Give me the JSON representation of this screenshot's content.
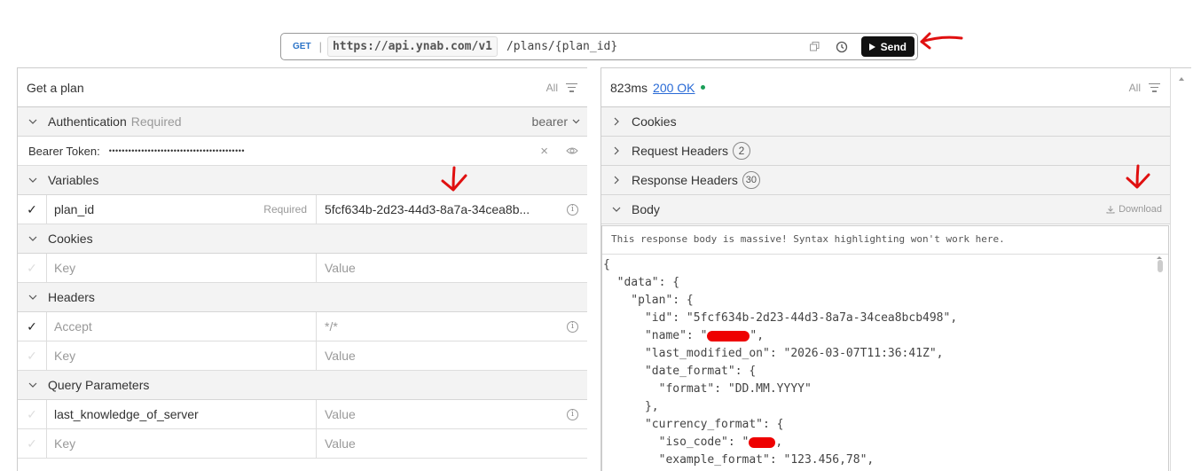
{
  "request": {
    "method": "GET",
    "base_url": "https://api.ynab.com/v1",
    "path": "/plans/{plan_id}",
    "send_label": "Send"
  },
  "left": {
    "title": "Get a plan",
    "filter_label": "All",
    "auth": {
      "label": "Authentication",
      "required": "Required",
      "type": "bearer"
    },
    "bearer_label": "Bearer Token:",
    "bearer_value": "••••••••••••••••••••••••••••••••••••••••••",
    "variables_label": "Variables",
    "variable": {
      "key": "plan_id",
      "tag": "Required",
      "value": "5fcf634b-2d23-44d3-8a7a-34cea8b..."
    },
    "cookies_label": "Cookies",
    "key_placeholder": "Key",
    "value_placeholder": "Value",
    "headers_label": "Headers",
    "header": {
      "key": "Accept",
      "value": "*/*"
    },
    "query_label": "Query Parameters",
    "query": {
      "key": "last_knowledge_of_server",
      "value": "Value"
    }
  },
  "right": {
    "time": "823ms",
    "status": "200 OK",
    "filter_label": "All",
    "cookies_label": "Cookies",
    "req_headers_label": "Request Headers",
    "req_headers_count": "2",
    "resp_headers_label": "Response Headers",
    "resp_headers_count": "30",
    "body_label": "Body",
    "download_label": "Download",
    "body_notice": "This response body is massive! Syntax highlighting won't work here.",
    "code": {
      "l1": "{",
      "l2": "  \"data\": {",
      "l3": "    \"plan\": {",
      "l4": "      \"id\": \"5fcf634b-2d23-44d3-8a7a-34cea8bcb498\",",
      "l5a": "      \"name\": \"",
      "l5b": "\",",
      "l6": "      \"last_modified_on\": \"2026-03-07T11:36:41Z\",",
      "l7": "      \"date_format\": {",
      "l8": "        \"format\": \"DD.MM.YYYY\"",
      "l9": "      },",
      "l10": "      \"currency_format\": {",
      "l11a": "        \"iso_code\": \"",
      "l11b": ",",
      "l12": "        \"example_format\": \"123.456,78\","
    }
  },
  "colors": {
    "accent_link": "#2a6bd6",
    "status_ok": "#1a9e57",
    "annotation": "#e01010"
  }
}
